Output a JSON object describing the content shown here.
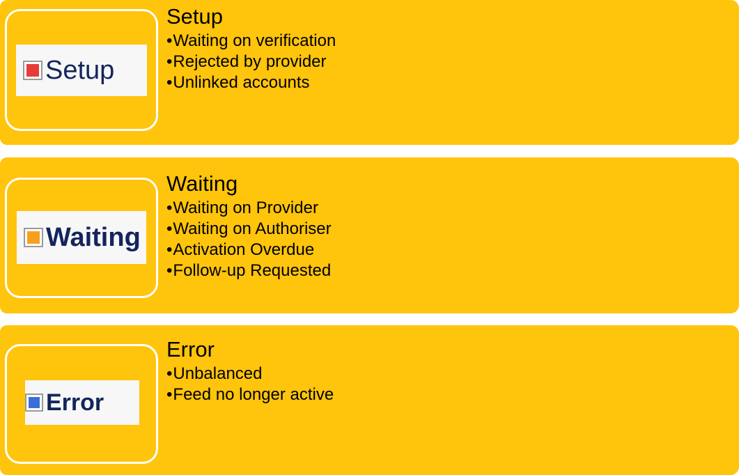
{
  "colors": {
    "panel_background": "#FFC40C",
    "frame_border": "#FFFFFF",
    "badge_background": "#F7F7F7",
    "badge_text": "#14255C"
  },
  "panels": [
    {
      "badge_label": "Setup",
      "status_color": "#E53B3B",
      "title": "Setup",
      "bullets": [
        "Waiting on verification",
        "Rejected by provider",
        "Unlinked accounts"
      ]
    },
    {
      "badge_label": "Waiting",
      "status_color": "#F5A11E",
      "title": "Waiting",
      "bullets": [
        "Waiting on Provider",
        "Waiting on Authoriser",
        "Activation Overdue",
        "Follow-up Requested"
      ]
    },
    {
      "badge_label": "Error",
      "status_color": "#3A6FD8",
      "title": "Error",
      "bullets": [
        "Unbalanced",
        "Feed no longer active"
      ]
    }
  ]
}
